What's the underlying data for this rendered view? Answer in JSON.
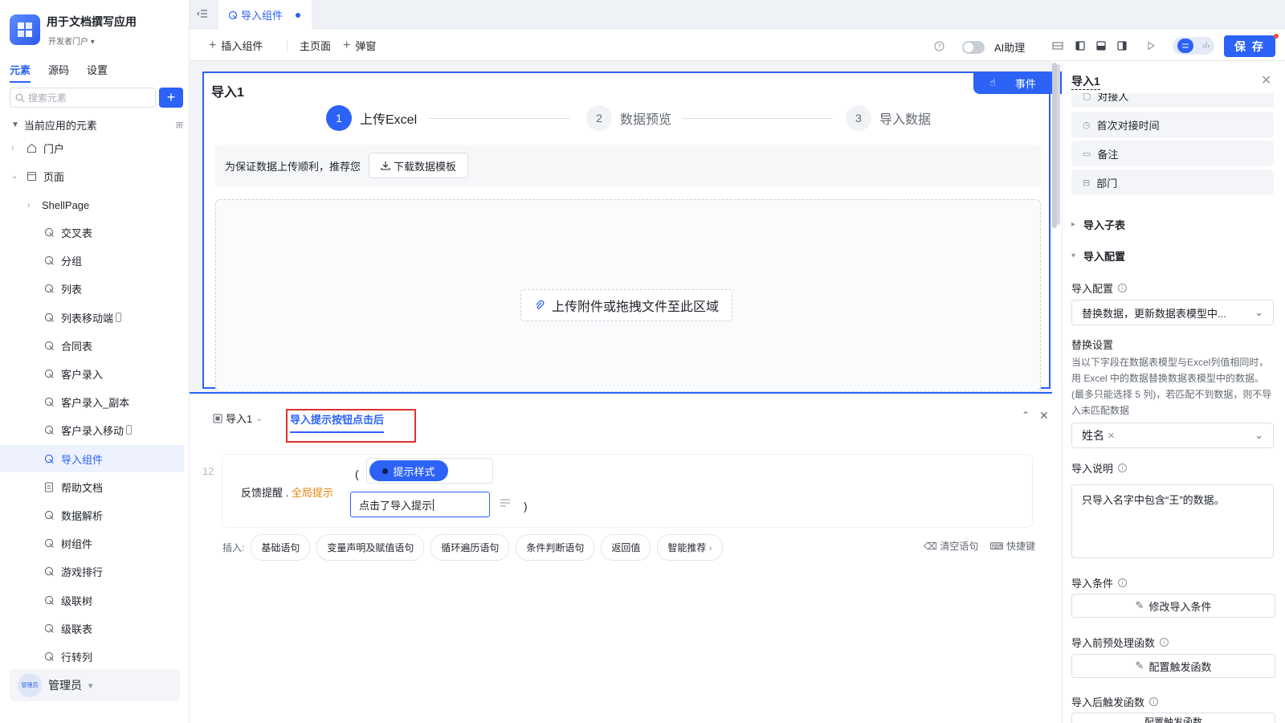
{
  "app": {
    "title": "用于文档撰写应用",
    "portal": "开发者门户"
  },
  "sidebar": {
    "tabs": [
      "元素",
      "源码",
      "设置"
    ],
    "search_placeholder": "搜索元素",
    "tree_header": "当前应用的元素",
    "groups": [
      "门户",
      "页面"
    ],
    "shell": "ShellPage",
    "pages": [
      "交叉表",
      "分组",
      "列表",
      "列表移动端",
      "合同表",
      "客户录入",
      "客户录入_副本",
      "客户录入移动",
      "导入组件",
      "帮助文档",
      "数据解析",
      "树组件",
      "游戏排行",
      "级联树",
      "级联表",
      "行转列"
    ],
    "selected": "导入组件",
    "user": {
      "name": "管理员",
      "avatar_text": "管理员"
    }
  },
  "topbar": {
    "tab_label": "导入组件"
  },
  "toolbar": {
    "insert": "插入组件",
    "main_page": "主页面",
    "popup": "弹窗",
    "ai_label": "AI助理",
    "save": "保 存"
  },
  "canvas": {
    "component_title": "导入1",
    "event_label": "事件",
    "steps": [
      {
        "num": "1",
        "label": "上传Excel"
      },
      {
        "num": "2",
        "label": "数据预览"
      },
      {
        "num": "3",
        "label": "导入数据"
      }
    ],
    "tip_text": "为保证数据上传顺利，推荐您",
    "download_btn": "下载数据模板",
    "upload_text": "上传附件或拖拽文件至此区域"
  },
  "bottom": {
    "tab1": "导入1",
    "tab2": "导入提示按钮点击后",
    "line_no": "12",
    "code_prefix": "反馈提醒 . ",
    "code_fn": "全局提示",
    "open_paren": "(",
    "close_paren": ")",
    "style_chip": "提示样式",
    "message_value": "点击了导入提示",
    "insert_label": "插入:",
    "insert_chips": [
      "基础语句",
      "变量声明及赋值语句",
      "循环遍历语句",
      "条件判断语句",
      "返回值",
      "智能推荐"
    ],
    "clear": "清空语句",
    "shortcut": "快捷键"
  },
  "rpanel": {
    "title": "导入1",
    "fields": [
      "对接人",
      "首次对接时间",
      "备注",
      "部门"
    ],
    "sec_subtable": "导入子表",
    "sec_config": "导入配置",
    "config_label": "导入配置",
    "config_value": "替换数据，更新数据表模型中...",
    "replace_label": "替换设置",
    "replace_desc": "当以下字段在数据表模型与Excel列值相同时，用 Excel 中的数据替换数据表模型中的数据。(最多只能选择 5 列)，若匹配不到数据，则不导入未匹配数据",
    "replace_tag": "姓名",
    "desc_label": "导入说明",
    "desc_value": "只导入名字中包含“王”的数据。",
    "cond_label": "导入条件",
    "cond_btn": "修改导入条件",
    "pre_label": "导入前预处理函数",
    "pre_btn": "配置触发函数",
    "post_label": "导入后触发函数",
    "post_btn": "配置触发函数"
  },
  "colors": {
    "accent": "#2c62f6",
    "highlight_box": "#e03131",
    "fn": "#e8840c"
  }
}
